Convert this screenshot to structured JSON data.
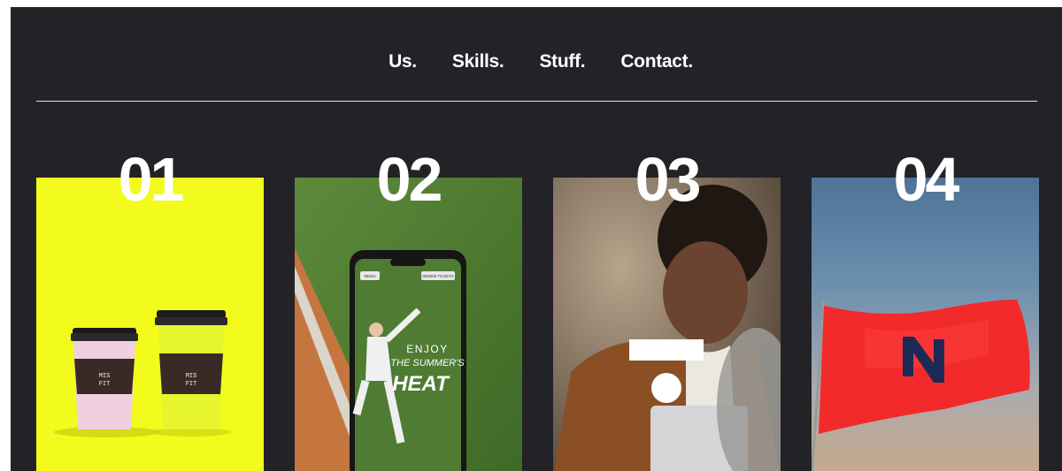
{
  "nav": {
    "items": [
      {
        "label": "Us."
      },
      {
        "label": "Skills."
      },
      {
        "label": "Stuff."
      },
      {
        "label": "Contact."
      }
    ]
  },
  "projects": [
    {
      "number": "01",
      "cup_text_line1": "MIS",
      "cup_text_line2": "FIT"
    },
    {
      "number": "02",
      "phone_menu": "MENU",
      "phone_renew": "RENEW TICKETS",
      "headline1": "ENJOY",
      "headline2": "THE SUMMER'S",
      "headline3": "HEAT"
    },
    {
      "number": "03"
    },
    {
      "number": "04"
    }
  ],
  "colors": {
    "background": "#232227",
    "card1": "#f2fb1c",
    "flag": "#f22a2a",
    "flag_logo": "#1d2a55"
  }
}
